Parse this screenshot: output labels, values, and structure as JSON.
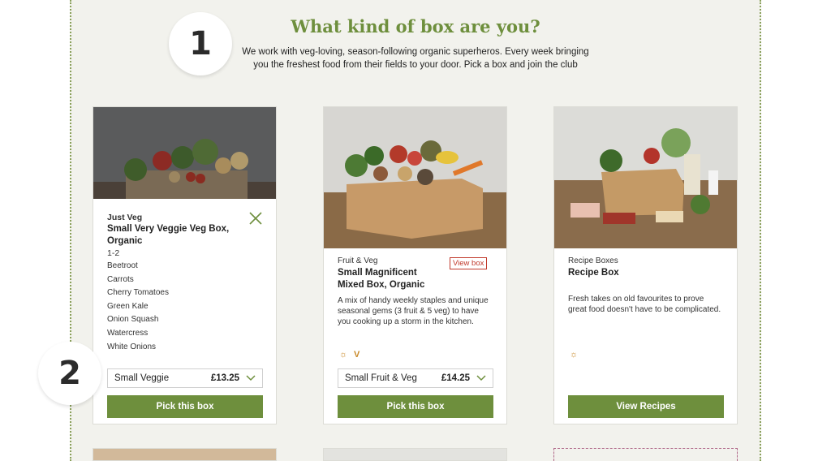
{
  "heading": "What kind of box are you?",
  "intro": "We work with veg-loving, season-following organic superheros. Every week bringing you the freshest food from their fields to your door. Pick a box and join the club",
  "steps": [
    "1",
    "2"
  ],
  "cards": [
    {
      "category": "Just Veg",
      "title": "Small Very Veggie Veg Box, Organic",
      "serves": "1-2",
      "contents": [
        "Beetroot",
        "Carrots",
        "Cherry Tomatoes",
        "Green Kale",
        "Onion Squash",
        "Watercress",
        "White Onions"
      ],
      "select_label": "Small Veggie",
      "price": "£13.25",
      "button": "Pick this box",
      "close_icon": "close-icon"
    },
    {
      "category": "Fruit & Veg",
      "title": "Small Magnificent Mixed Box, Organic",
      "view_link": "View box",
      "description": "A mix of handy weekly staples and unique seasonal gems (3 fruit & 5 veg) to have you cooking up a storm in the kitchen.",
      "select_label": "Small Fruit & Veg",
      "price": "£14.25",
      "button": "Pick this box",
      "badges": [
        "organic-icon",
        "vegetarian-icon"
      ]
    },
    {
      "category": "Recipe Boxes",
      "title": "Recipe Box",
      "description": "Fresh takes on old favourites to prove great food doesn't have to be complicated.",
      "button": "View Recipes",
      "badges": [
        "organic-icon"
      ]
    }
  ],
  "colors": {
    "accent": "#6e8f3d",
    "panel": "#f2f2ed",
    "link": "#c0392b"
  }
}
